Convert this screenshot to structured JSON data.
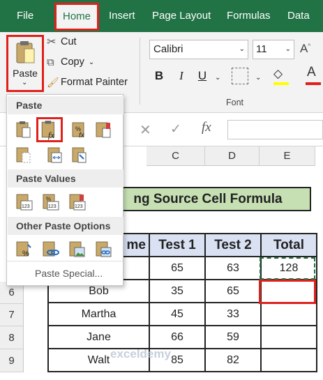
{
  "ribbon": {
    "tabs": [
      "File",
      "Home",
      "Insert",
      "Page Layout",
      "Formulas",
      "Data"
    ],
    "clipboard": {
      "paste_label": "Paste",
      "cut_label": "Cut",
      "copy_label": "Copy",
      "format_painter_label": "Format Painter"
    },
    "font": {
      "name": "Calibri",
      "size": "11",
      "group_label": "Font"
    }
  },
  "paste_menu": {
    "paste_header": "Paste",
    "paste_values_header": "Paste Values",
    "other_header": "Other Paste Options",
    "paste_special_label": "Paste Special..."
  },
  "formula_bar": {
    "fx_label": "fx"
  },
  "grid": {
    "column_headers": [
      "C",
      "D",
      "E"
    ],
    "row_headers": [
      "6",
      "7",
      "8",
      "9"
    ],
    "banner": "ng Source Cell Formula",
    "table_headers": [
      "me",
      "Test 1",
      "Test 2",
      "Total"
    ],
    "rows": [
      [
        "",
        "65",
        "63",
        "128"
      ],
      [
        "Bob",
        "35",
        "65",
        ""
      ],
      [
        "Martha",
        "45",
        "33",
        ""
      ],
      [
        "Jane",
        "66",
        "59",
        ""
      ],
      [
        "Walt",
        "85",
        "82",
        ""
      ]
    ]
  },
  "watermark": "exceldemy",
  "colors": {
    "accent": "#217346",
    "highlight": "#e0201b",
    "banner": "#c6e0b4",
    "header": "#d9e1f2"
  }
}
